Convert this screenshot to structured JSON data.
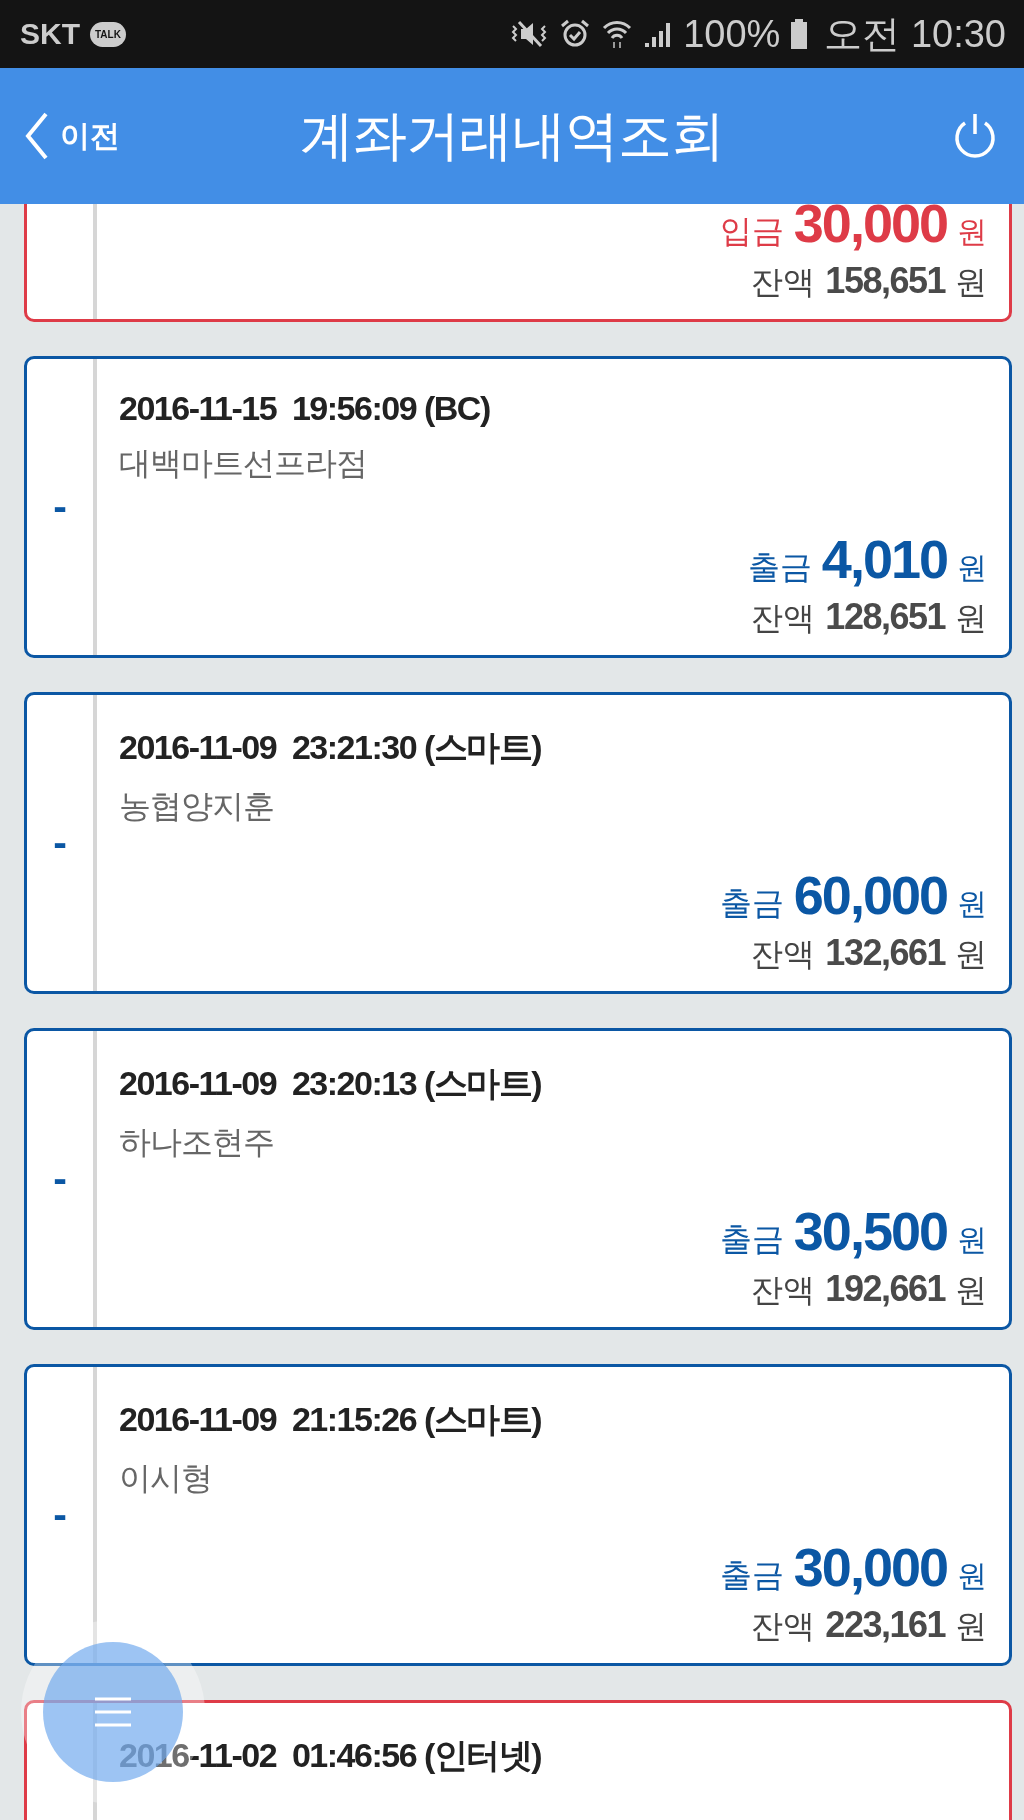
{
  "status_bar": {
    "carrier": "SKT",
    "talk_badge": "TALK",
    "battery": "100%",
    "time": "오전 10:30"
  },
  "header": {
    "back_label": "이전",
    "title": "계좌거래내역조회"
  },
  "transactions": [
    {
      "kind": "deposit",
      "amount_label": "입금",
      "amount": "30,000",
      "amount_unit": "원",
      "balance_label": "잔액",
      "balance": "158,651",
      "balance_unit": "원"
    },
    {
      "kind": "withdrawal",
      "sign": "-",
      "datetime": "2016-11-15  19:56:09 (BC)",
      "merchant": "대백마트선프라점",
      "amount_label": "출금",
      "amount": "4,010",
      "amount_unit": "원",
      "balance_label": "잔액",
      "balance": "128,651",
      "balance_unit": "원"
    },
    {
      "kind": "withdrawal",
      "sign": "-",
      "datetime": "2016-11-09  23:21:30 (스마트)",
      "merchant": "농협양지훈",
      "amount_label": "출금",
      "amount": "60,000",
      "amount_unit": "원",
      "balance_label": "잔액",
      "balance": "132,661",
      "balance_unit": "원"
    },
    {
      "kind": "withdrawal",
      "sign": "-",
      "datetime": "2016-11-09  23:20:13 (스마트)",
      "merchant": "하나조현주",
      "amount_label": "출금",
      "amount": "30,500",
      "amount_unit": "원",
      "balance_label": "잔액",
      "balance": "192,661",
      "balance_unit": "원"
    },
    {
      "kind": "withdrawal",
      "sign": "-",
      "datetime": "2016-11-09  21:15:26 (스마트)",
      "merchant": "이시형",
      "amount_label": "출금",
      "amount": "30,000",
      "amount_unit": "원",
      "balance_label": "잔액",
      "balance": "223,161",
      "balance_unit": "원"
    },
    {
      "kind": "deposit",
      "datetime": "2016-11-02  01:46:56 (인터넷)"
    }
  ]
}
